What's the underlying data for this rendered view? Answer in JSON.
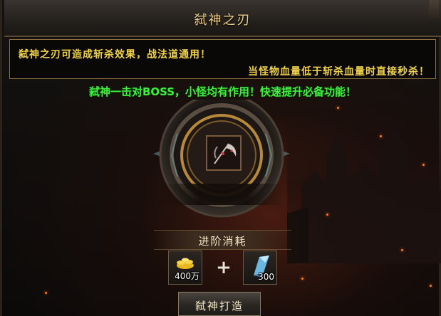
{
  "panel": {
    "title": "弑神之刃"
  },
  "description": {
    "line1": "弑神之刃可造成斩杀效果，战法道通用！",
    "line2": "当怪物血量低于斩杀血量时直接秒杀！"
  },
  "note": "弑神一击对BOSS，小怪均有作用！快速提升必备功能！",
  "upgrade": {
    "cost_label": "进阶消耗",
    "materials": [
      {
        "icon": "gold-ingot-icon",
        "quantity": "400万"
      },
      {
        "icon": "crystal-shard-icon",
        "quantity": "300"
      }
    ],
    "plus_sign": "+",
    "button_label": "弑神打造"
  },
  "colors": {
    "title": "#e9c98e",
    "description": "#f0d34a",
    "note": "#3df03d",
    "frame_gold": "#8a6f3e"
  }
}
